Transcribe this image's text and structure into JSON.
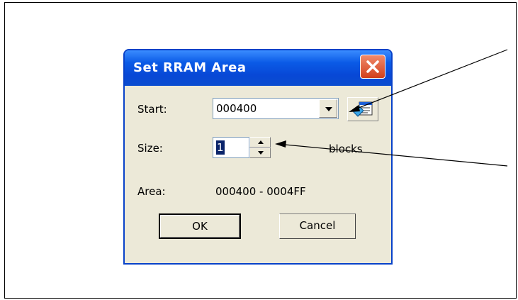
{
  "dialog": {
    "title": "Set RRAM Area",
    "start_label": "Start:",
    "start_value": "000400",
    "size_label": "Size:",
    "size_value": "1",
    "blocks_label": "blocks",
    "area_label": "Area:",
    "area_value": "000400 - 0004FF",
    "ok_label": "OK",
    "cancel_label": "Cancel"
  },
  "icons": {
    "close": "close-icon",
    "dropdown": "chevron-down-icon",
    "browse": "symbol-browser-icon",
    "spin_up": "spin-up-icon",
    "spin_down": "spin-down-icon"
  }
}
